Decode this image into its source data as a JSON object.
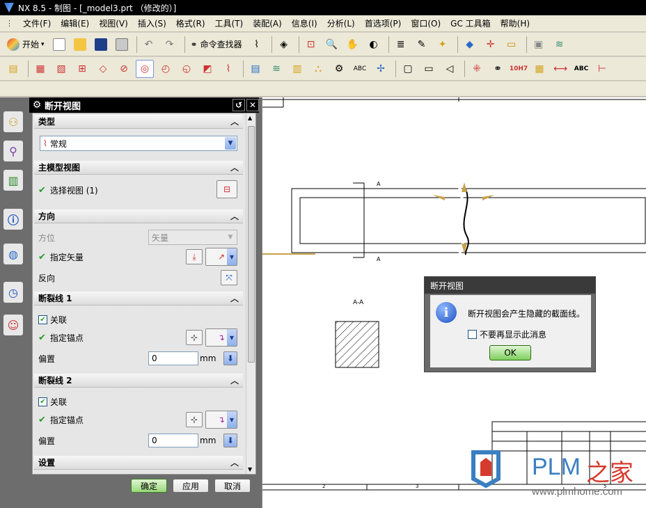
{
  "window": {
    "title": "NX 8.5 - 制图 - [_model3.prt （修改的）]"
  },
  "menu": [
    "文件(F)",
    "编辑(E)",
    "视图(V)",
    "插入(S)",
    "格式(R)",
    "工具(T)",
    "装配(A)",
    "信息(I)",
    "分析(L)",
    "首选项(P)",
    "窗口(O)",
    "GC 工具箱",
    "帮助(H)"
  ],
  "toolbar": {
    "start_label": "开始",
    "command_finder_label": "命令查找器",
    "tolerance_label": "10H7",
    "abc_label": "ABC"
  },
  "panel": {
    "title": "断开视图",
    "sections": {
      "type": {
        "label": "类型",
        "value": "常规"
      },
      "main_view": {
        "label": "主模型视图",
        "select_label": "选择视图 (1)"
      },
      "direction": {
        "label": "方向",
        "orientation_label": "方位",
        "orientation_value": "矢量",
        "vector_label": "指定矢量",
        "reverse_label": "反向"
      },
      "break1": {
        "label": "断裂线 1",
        "assoc_label": "关联",
        "anchor_label": "指定锚点",
        "offset_label": "偏置",
        "offset_value": "0",
        "unit": "mm"
      },
      "break2": {
        "label": "断裂线 2",
        "assoc_label": "关联",
        "anchor_label": "指定锚点",
        "offset_label": "偏置",
        "offset_value": "0",
        "unit": "mm"
      },
      "settings": {
        "label": "设置"
      }
    },
    "buttons": {
      "ok": "确定",
      "apply": "应用",
      "cancel": "取消"
    }
  },
  "drawing": {
    "section_label_a1": "A",
    "section_label_a2": "A",
    "section_view_label": "A-A",
    "zone_1": "2",
    "zone_2": "3",
    "zone_3": "5"
  },
  "message": {
    "title": "断开视图",
    "text": "断开视图会产生隐藏的截面线。",
    "checkbox_label": "不要再显示此消息",
    "ok": "OK"
  },
  "watermark": {
    "brand": "PLM",
    "cn": "之家",
    "url": "www.plmhome.com"
  },
  "colors": {
    "title_bg": "#000000",
    "panel_bg": "#6d6d6d",
    "accent_green": "#98d87a",
    "watermark_blue": "#3a7fc1",
    "watermark_red": "#d63a2e"
  }
}
